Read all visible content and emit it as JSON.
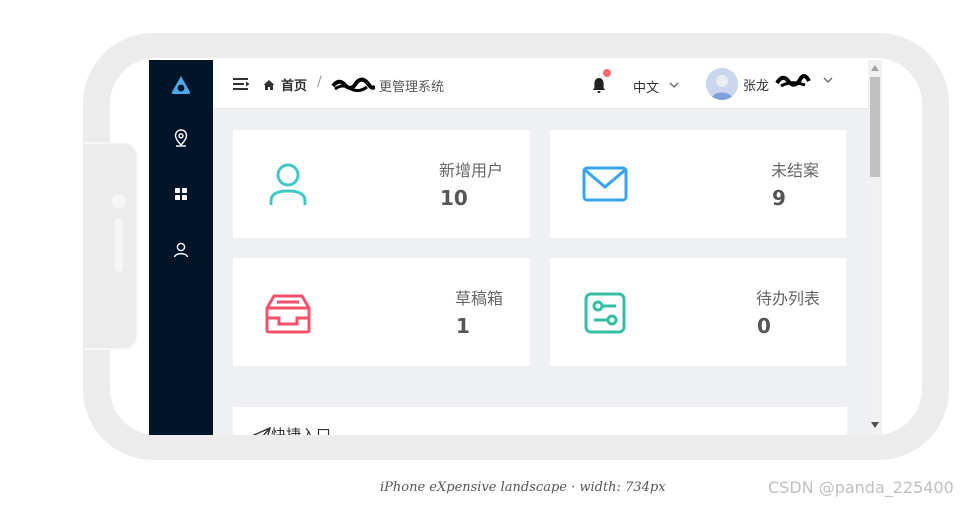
{
  "breadcrumb": {
    "home_label": "首页",
    "separator": "/",
    "current_label": "更管理系统"
  },
  "header": {
    "language": "中文",
    "user_name": "张龙",
    "notification_dot_color": "#f56c6c"
  },
  "sidebar": {
    "items": [
      {
        "icon": "location-icon"
      },
      {
        "icon": "grid-icon"
      },
      {
        "icon": "user-icon"
      }
    ]
  },
  "cards": [
    {
      "title": "新增用户",
      "value": "10",
      "icon": "user-icon",
      "color": "#40c9c6"
    },
    {
      "title": "未结案",
      "value": "9",
      "icon": "mail-icon",
      "color": "#36a3f7"
    },
    {
      "title": "草稿箱",
      "value": "1",
      "icon": "inbox-icon",
      "color": "#f4516c"
    },
    {
      "title": "待办列表",
      "value": "0",
      "icon": "todo-icon",
      "color": "#34bfa3"
    }
  ],
  "quick_entry": {
    "label": "快捷入口"
  },
  "caption": "iPhone eXpensive landscape · width: 734px",
  "watermark": "CSDN @panda_225400",
  "colors": {
    "sidebar_bg": "#00152a",
    "logo": "#4ea8e6"
  }
}
